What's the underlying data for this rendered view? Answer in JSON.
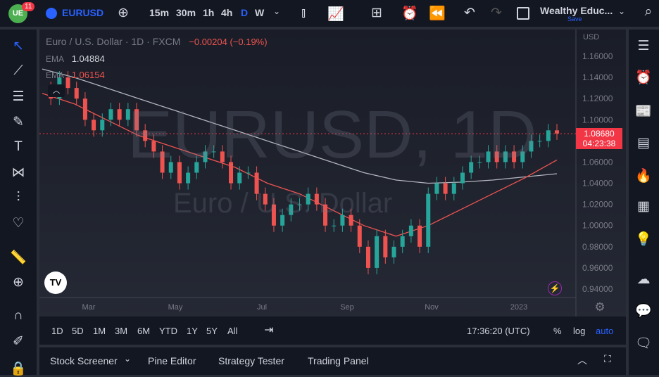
{
  "toolbar": {
    "badge": "11",
    "symbol": "EURUSD",
    "intervals": [
      "15m",
      "30m",
      "1h",
      "4h",
      "D",
      "W"
    ],
    "layout_name": "Wealthy Educ...",
    "save": "Save"
  },
  "legend": {
    "title": "Euro / U.S. Dollar · 1D · FXCM",
    "change": "−0.00204 (−0.19%)",
    "ema1_label": "EMA",
    "ema1_value": "1.04884",
    "ema2_label": "EMA",
    "ema2_value": "1.06154"
  },
  "watermark": {
    "symbol": "EURUSD, 1D",
    "name": "Euro / U.S. Dollar"
  },
  "price_axis": {
    "currency": "USD",
    "current_price": "1.08680",
    "countdown": "04:23:38"
  },
  "range_bar": {
    "ranges": [
      "1D",
      "5D",
      "1M",
      "3M",
      "6M",
      "YTD",
      "1Y",
      "5Y",
      "All"
    ],
    "time": "17:36:20 (UTC)",
    "percent": "%",
    "log": "log",
    "auto": "auto"
  },
  "bottom_tabs": [
    "Stock Screener",
    "Pine Editor",
    "Strategy Tester",
    "Trading Panel"
  ],
  "colors": {
    "up": "#26a69a",
    "down": "#ef5350",
    "accent": "#2962ff"
  },
  "chart_data": {
    "type": "candlestick",
    "ylim": [
      0.93,
      1.17
    ],
    "yticks": [
      "1.16000",
      "1.14000",
      "1.12000",
      "1.10000",
      "1.08000",
      "1.06000",
      "1.04000",
      "1.02000",
      "1.00000",
      "0.98000",
      "0.96000",
      "0.94000"
    ],
    "xticks": [
      "Mar",
      "May",
      "Jul",
      "Sep",
      "Nov",
      "2023"
    ],
    "closes": [
      1.13,
      1.12,
      1.14,
      1.13,
      1.12,
      1.1,
      1.09,
      1.1,
      1.11,
      1.1,
      1.11,
      1.09,
      1.08,
      1.07,
      1.05,
      1.06,
      1.04,
      1.05,
      1.06,
      1.07,
      1.07,
      1.06,
      1.04,
      1.05,
      1.05,
      1.03,
      1.02,
      1.0,
      1.01,
      1.02,
      1.02,
      1.03,
      1.02,
      1.0,
      1.0,
      1.01,
      1.0,
      0.98,
      0.96,
      0.99,
      0.97,
      0.98,
      0.99,
      1.0,
      0.98,
      1.03,
      1.04,
      1.03,
      1.04,
      1.05,
      1.06,
      1.06,
      1.07,
      1.06,
      1.07,
      1.06,
      1.07,
      1.08,
      1.08,
      1.09,
      1.087
    ],
    "ema_long": [
      1.148,
      1.14,
      1.13,
      1.12,
      1.11,
      1.1,
      1.09,
      1.08,
      1.07,
      1.06,
      1.05,
      1.043,
      1.04,
      1.041,
      1.043,
      1.046,
      1.049
    ],
    "ema_short": [
      1.125,
      1.115,
      1.1,
      1.085,
      1.075,
      1.065,
      1.055,
      1.04,
      1.03,
      1.015,
      1.0,
      0.99,
      1.0,
      1.015,
      1.03,
      1.045,
      1.062
    ]
  }
}
